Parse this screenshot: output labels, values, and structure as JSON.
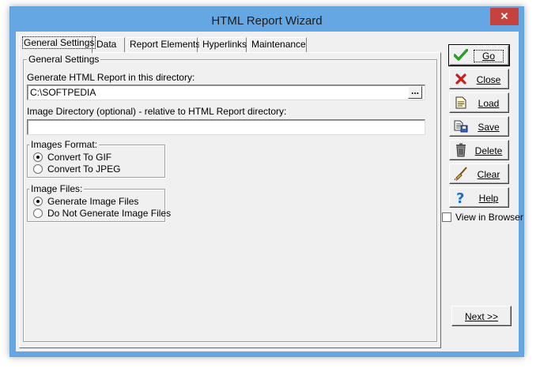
{
  "window": {
    "title": "HTML Report Wizard",
    "close_glyph": "✕"
  },
  "tabs": [
    {
      "label": "General Settings",
      "active": true
    },
    {
      "label": "Data"
    },
    {
      "label": "Report Elements"
    },
    {
      "label": "Hyperlinks"
    },
    {
      "label": "Maintenance"
    }
  ],
  "general_settings": {
    "group_title": "General Settings",
    "dir_label": "Generate HTML Report in this directory:",
    "dir_value": "C:\\SOFTPEDIA",
    "browse_label": "...",
    "image_dir_label": "Image Directory (optional) - relative to HTML Report directory:",
    "image_dir_value": "",
    "images_format": {
      "title": "Images Format:",
      "options": [
        {
          "label": "Convert To GIF",
          "checked": true
        },
        {
          "label": "Convert To JPEG",
          "checked": false
        }
      ]
    },
    "image_files": {
      "title": "Image Files:",
      "options": [
        {
          "label": "Generate Image Files",
          "checked": true
        },
        {
          "label": "Do Not Generate Image Files",
          "checked": false
        }
      ]
    }
  },
  "buttons": {
    "go": "Go",
    "close": "Close",
    "load": "Load",
    "save": "Save",
    "delete": "Delete",
    "clear": "Clear",
    "help": "Help",
    "next": "Next >>"
  },
  "view_in_browser": {
    "label": "View in Browser",
    "checked": false
  },
  "colors": {
    "title_bar": "#65a7e2",
    "close_button": "#c7423c",
    "go_icon": "#2a9d2a",
    "close_icon": "#c81e1e",
    "help_icon": "#1e6ad2"
  }
}
